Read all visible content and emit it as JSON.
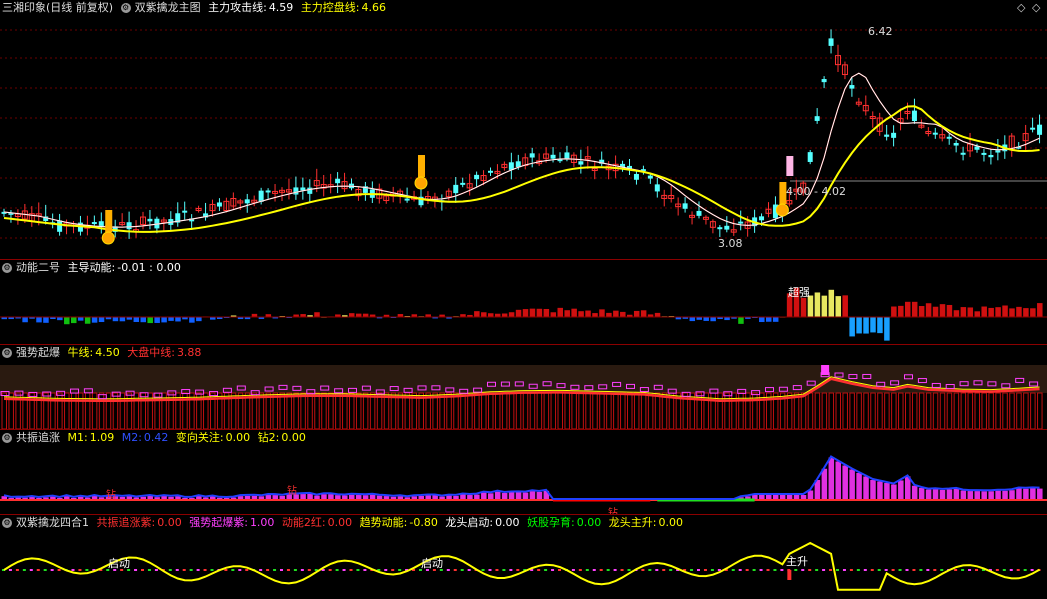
{
  "main_pane": {
    "title": "三湘印象(日线 前复权)",
    "indicator_name": "双紫擒龙主图",
    "values": [
      {
        "label": "主力攻击线:",
        "value": "4.59",
        "color": "#ffffff"
      },
      {
        "label": "主力控盘线:",
        "value": "4.66",
        "color": "#ffff00"
      }
    ],
    "annotations": {
      "high": "6.42",
      "low": "3.08",
      "mid": "4.00 - 4.02"
    },
    "controls": {
      "left_arrow": "◇",
      "right_arrow": "◇"
    }
  },
  "pane2": {
    "name": "动能二号",
    "values": [
      {
        "label": "主导动能:",
        "value": "-0.01 : 0.00",
        "color": "#ffffff"
      }
    ],
    "annotation": "超强"
  },
  "pane3": {
    "name": "强势起爆",
    "values": [
      {
        "label": "牛线:",
        "value": "4.50",
        "color": "#ffff00"
      },
      {
        "label": "大盘中线:",
        "value": "3.88",
        "color": "#ff3030"
      }
    ]
  },
  "pane4": {
    "name": "共振追涨",
    "values": [
      {
        "label": "M1:",
        "value": "1.09",
        "color": "#ffff00"
      },
      {
        "label": "M2:",
        "value": "0.42",
        "color": "#3050ff"
      },
      {
        "label": "变向关注:",
        "value": "0.00",
        "color": "#ffff00"
      },
      {
        "label": "钻2:",
        "value": "0.00",
        "color": "#ffff00"
      }
    ],
    "marker": "钻"
  },
  "pane5": {
    "name": "双紫擒龙四合1",
    "values": [
      {
        "label": "共振追涨紫:",
        "value": "0.00",
        "color": "#ff3030"
      },
      {
        "label": "强势起爆紫:",
        "value": "1.00",
        "color": "#ff40ff"
      },
      {
        "label": "动能2红:",
        "value": "0.00",
        "color": "#ff3030"
      },
      {
        "label": "趋势动能:",
        "value": "-0.80",
        "color": "#ffff00"
      },
      {
        "label": "龙头启动:",
        "value": "0.00",
        "color": "#ffffff"
      },
      {
        "label": "妖股孕育:",
        "value": "0.00",
        "color": "#00ff00"
      },
      {
        "label": "龙头主升:",
        "value": "0.00",
        "color": "#ffff00"
      }
    ],
    "annotations": [
      "启动",
      "启动",
      "主升"
    ]
  }
}
